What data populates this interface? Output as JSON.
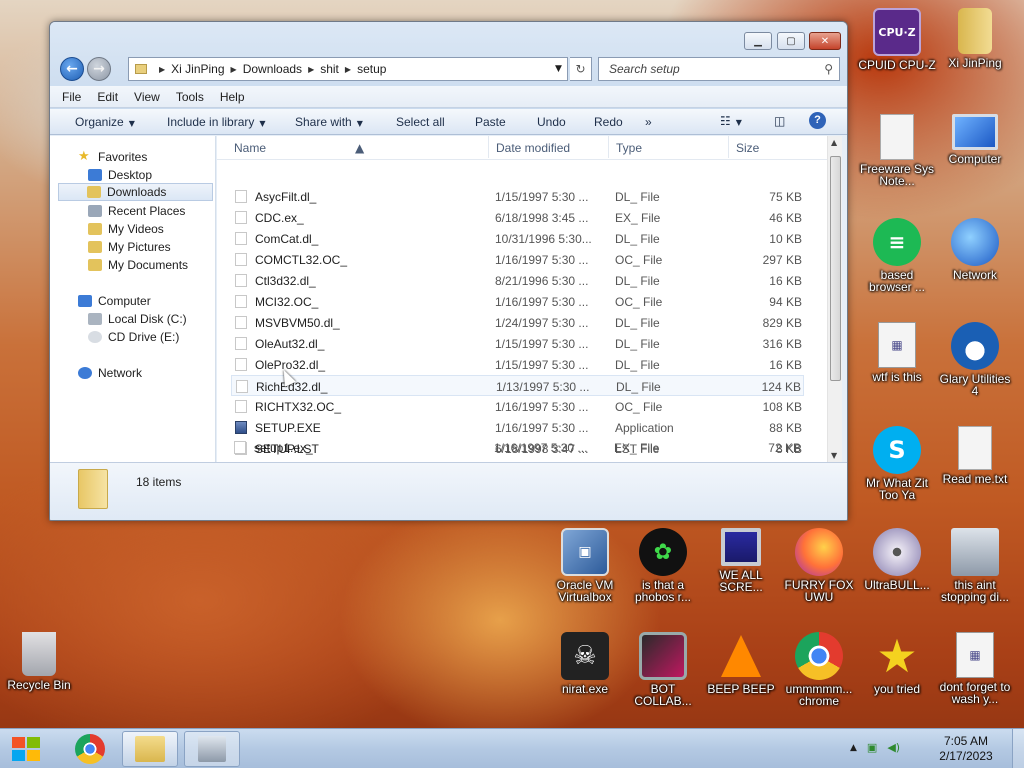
{
  "window": {
    "breadcrumb": [
      "Xi JinPing",
      "Downloads",
      "shit",
      "setup"
    ],
    "search_placeholder": "Search setup",
    "menu": [
      "File",
      "Edit",
      "View",
      "Tools",
      "Help"
    ],
    "toolbar": {
      "organize": "Organize",
      "include_in_library": "Include in library",
      "share_with": "Share with",
      "select_all": "Select all",
      "paste": "Paste",
      "undo": "Undo",
      "redo": "Redo",
      "more": "»"
    },
    "nav": {
      "favorites": "Favorites",
      "desktop": "Desktop",
      "downloads": "Downloads",
      "recent_places": "Recent Places",
      "my_videos": "My Videos",
      "my_pictures": "My Pictures",
      "my_documents": "My Documents",
      "computer": "Computer",
      "local_disk": "Local Disk (C:)",
      "cd_drive": "CD Drive (E:)",
      "network": "Network"
    },
    "columns": {
      "name": "Name",
      "date": "Date modified",
      "type": "Type",
      "size": "Size"
    },
    "files": [
      {
        "name": "AsycFilt.dl_",
        "date": "1/15/1997 5:30 ...",
        "type": "DL_ File",
        "size": "75 KB"
      },
      {
        "name": "CDC.ex_",
        "date": "6/18/1998 3:45 ...",
        "type": "EX_ File",
        "size": "46 KB"
      },
      {
        "name": "ComCat.dl_",
        "date": "10/31/1996 5:30...",
        "type": "DL_ File",
        "size": "10 KB"
      },
      {
        "name": "COMCTL32.OC_",
        "date": "1/16/1997 5:30 ...",
        "type": "OC_ File",
        "size": "297 KB"
      },
      {
        "name": "Ctl3d32.dl_",
        "date": "8/21/1996 5:30 ...",
        "type": "DL_ File",
        "size": "16 KB"
      },
      {
        "name": "MCI32.OC_",
        "date": "1/16/1997 5:30 ...",
        "type": "OC_ File",
        "size": "94 KB"
      },
      {
        "name": "MSVBVM50.dl_",
        "date": "1/24/1997 5:30 ...",
        "type": "DL_ File",
        "size": "829 KB"
      },
      {
        "name": "OleAut32.dl_",
        "date": "1/15/1997 5:30 ...",
        "type": "DL_ File",
        "size": "316 KB"
      },
      {
        "name": "OlePro32.dl_",
        "date": "1/15/1997 5:30 ...",
        "type": "DL_ File",
        "size": "16 KB"
      },
      {
        "name": "RichEd32.dl_",
        "date": "1/13/1997 5:30 ...",
        "type": "DL_ File",
        "size": "124 KB"
      },
      {
        "name": "RICHTX32.OC_",
        "date": "1/16/1997 5:30 ...",
        "type": "OC_ File",
        "size": "108 KB"
      },
      {
        "name": "SETUP.EXE",
        "date": "1/16/1997 5:30 ...",
        "type": "Application",
        "size": "88 KB"
      },
      {
        "name": "SETUP.LST",
        "date": "6/18/1998 3:47 ...",
        "type": "LST File",
        "size": "8 KB"
      },
      {
        "name": "setup1.ex_",
        "date": "1/16/1997 5:30 ...",
        "type": "EX_ File",
        "size": "72 KB"
      }
    ],
    "item_count": "18 items"
  },
  "desktop": {
    "icons": [
      {
        "label": "CPUID CPU-Z",
        "icon": "cpuz-icon",
        "color": "#5a2a8a"
      },
      {
        "label": "Xi JinPing",
        "icon": "user-folder-icon",
        "color": "#e3c35c"
      },
      {
        "label": "Freeware Sys Note...",
        "icon": "document-icon",
        "color": "#f4f4f4"
      },
      {
        "label": "Computer",
        "icon": "computer-icon",
        "color": "#2c6fd1"
      },
      {
        "label": "based browser ...",
        "icon": "chat-icon",
        "color": "#1db954"
      },
      {
        "label": "Network",
        "icon": "network-icon",
        "color": "#2c6fd1"
      },
      {
        "label": "wtf is this",
        "icon": "installer-icon",
        "color": "#f4f4f4"
      },
      {
        "label": "Glary Utilities 4",
        "icon": "glary-icon",
        "color": "#1a5fb4"
      },
      {
        "label": "Mr What Zit Too Ya",
        "icon": "skype-icon",
        "color": "#00aff0"
      },
      {
        "label": "Read me.txt",
        "icon": "text-file-icon",
        "color": "#f4f4f4"
      },
      {
        "label": "Oracle VM Virtualbox",
        "icon": "virtualbox-icon",
        "color": "#2d5b9a"
      },
      {
        "label": "is that a phobos r...",
        "icon": "icq-icon",
        "color": "#111111"
      },
      {
        "label": "WE ALL SCRE...",
        "icon": "computer-old-icon",
        "color": "#9aa7b8"
      },
      {
        "label": "FURRY FOX UWU",
        "icon": "firefox-icon",
        "color": "#ff7139"
      },
      {
        "label": "UltraBULL...",
        "icon": "disc-icon",
        "color": "#c9c3d9"
      },
      {
        "label": "this aint stopping di...",
        "icon": "scanner-icon",
        "color": "#9aa7b8"
      },
      {
        "label": "Recycle Bin",
        "icon": "recycle-bin-icon",
        "color": "#cfe3f1"
      },
      {
        "label": "nirat.exe",
        "icon": "skull-icon",
        "color": "#222222"
      },
      {
        "label": "BOT COLLAB...",
        "icon": "video-editor-icon",
        "color": "#c01860"
      },
      {
        "label": "BEEP BEEP",
        "icon": "vlc-icon",
        "color": "#ff8800"
      },
      {
        "label": "ummmmm... chrome",
        "icon": "chrome-icon",
        "color": "#e33b2e"
      },
      {
        "label": "you tried",
        "icon": "star-icon",
        "color": "#f4d21f"
      },
      {
        "label": "dont forget to wash y...",
        "icon": "installer-icon",
        "color": "#f4f4f4"
      }
    ]
  },
  "taskbar": {
    "time": "7:05 AM",
    "date": "2/17/2023"
  }
}
